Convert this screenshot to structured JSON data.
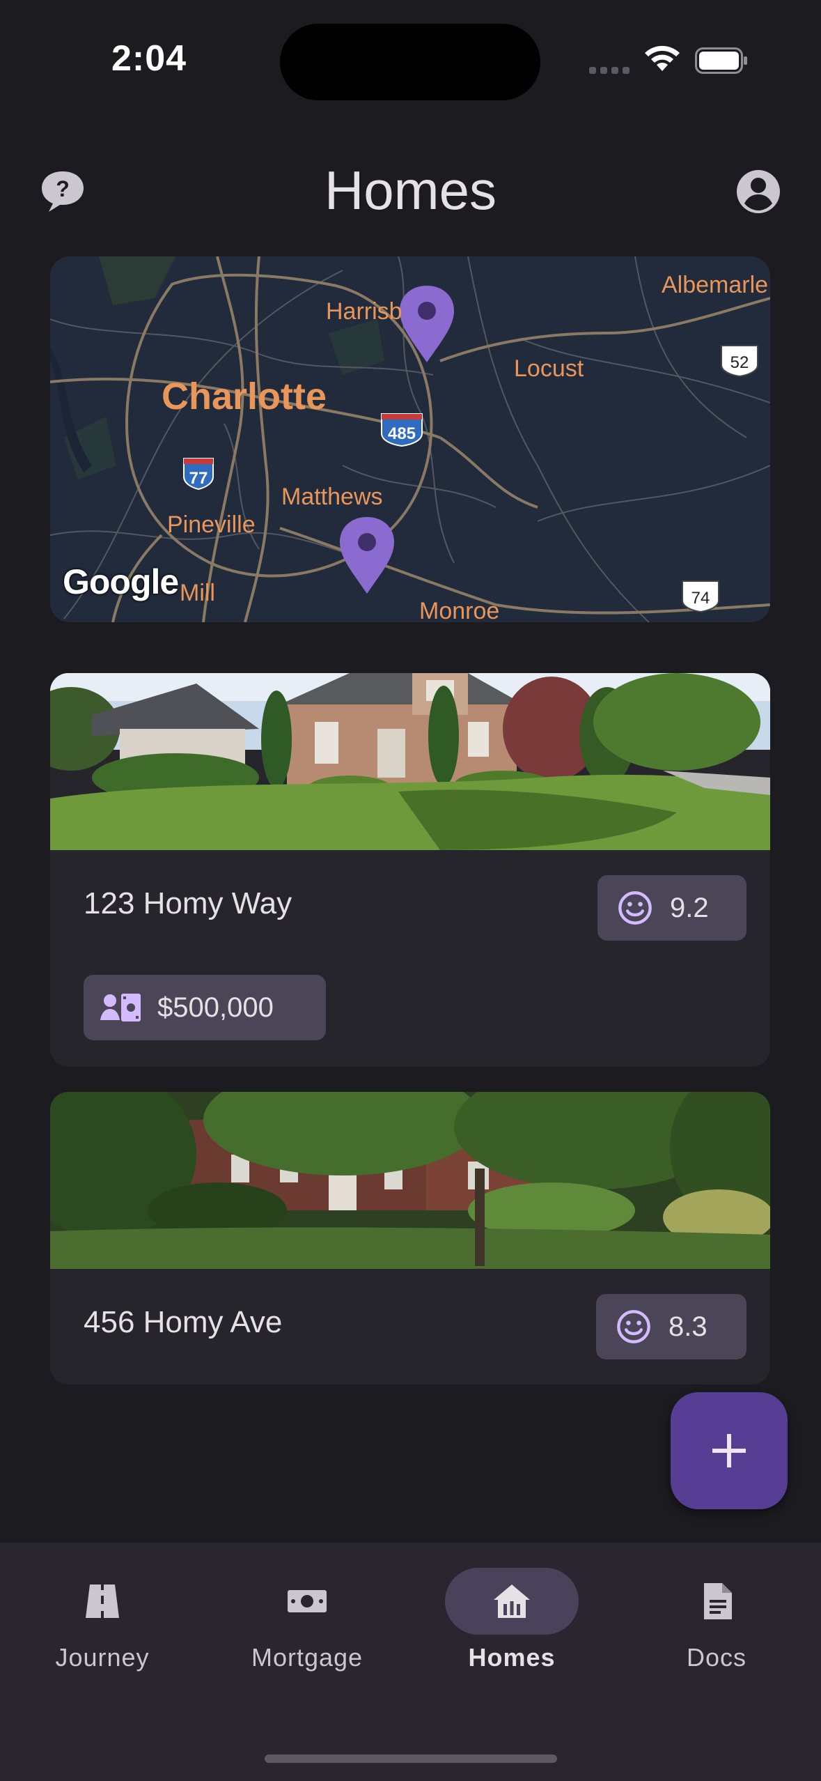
{
  "status_bar": {
    "time": "2:04"
  },
  "header": {
    "title": "Homes",
    "help_icon": "help-bubble-icon",
    "profile_icon": "account-circle-icon"
  },
  "map": {
    "labels": [
      "Harrisb",
      "Albemarle",
      "Locust",
      "Charlotte",
      "Matthews",
      "Pineville",
      "Mill",
      "Monroe"
    ],
    "route_shields": [
      "485",
      "77",
      "52",
      "74"
    ],
    "attribution": "Google",
    "pin_color": "#8c6bd1"
  },
  "homes": [
    {
      "address": "123 Homy Way",
      "score": "9.2",
      "price": "$500,000",
      "score_icon": "smiley-icon",
      "price_icon": "contact-money-icon"
    },
    {
      "address": "456 Homy Ave",
      "score": "8.3",
      "score_icon": "smiley-icon"
    }
  ],
  "fab": {
    "icon": "plus-icon"
  },
  "bottom_nav": {
    "items": [
      {
        "label": "Journey",
        "icon": "road-icon"
      },
      {
        "label": "Mortgage",
        "icon": "banknote-icon"
      },
      {
        "label": "Homes",
        "icon": "home-icon",
        "active": true
      },
      {
        "label": "Docs",
        "icon": "document-icon"
      }
    ]
  },
  "colors": {
    "background": "#1c1b20",
    "card": "#27252c",
    "chip": "#4a4557",
    "accent": "#553e94",
    "nav": "#29262f",
    "map_text": "#e8965a"
  }
}
